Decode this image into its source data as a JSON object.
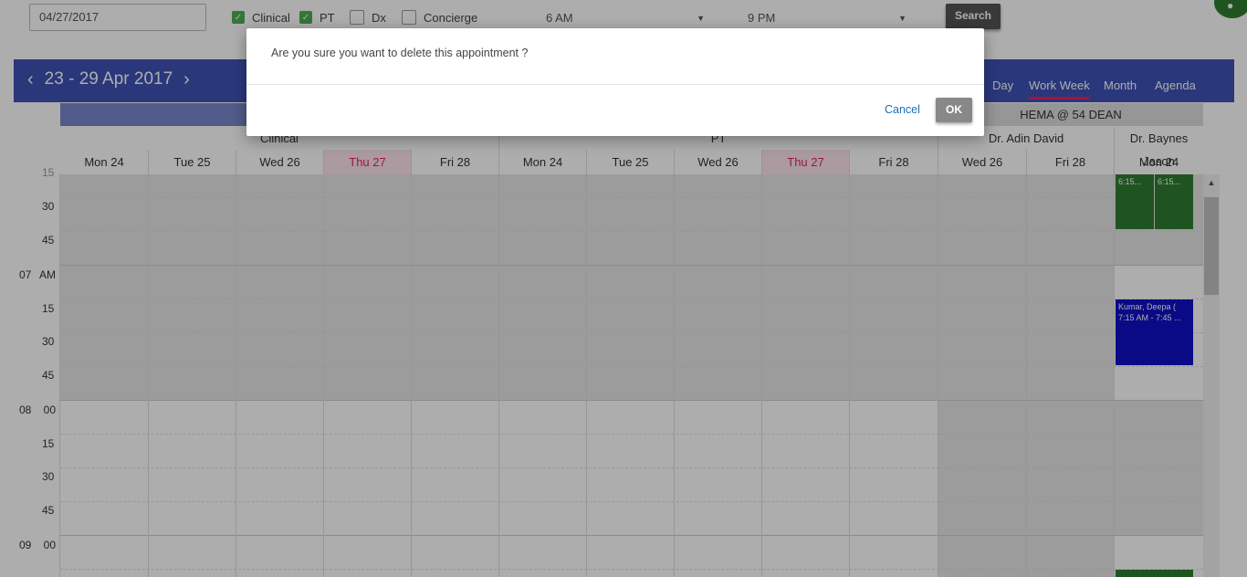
{
  "filters": {
    "date_value": "04/27/2017",
    "checkboxes": [
      {
        "label": "Clinical",
        "checked": true
      },
      {
        "label": "PT",
        "checked": true
      },
      {
        "label": "Dx",
        "checked": false
      },
      {
        "label": "Concierge",
        "checked": false
      }
    ],
    "start_time": "6 AM",
    "end_time": "9 PM",
    "search_label": "Search"
  },
  "header": {
    "date_range": "23 - 29 Apr 2017",
    "prev_icon": "chevron-left-icon",
    "next_icon": "chevron-right-icon",
    "views": [
      "Day",
      "Work Week",
      "Month",
      "Agenda"
    ],
    "active_view": "Work Week",
    "header_color": "#3f51b5"
  },
  "scheduler": {
    "group_label": "HEMA @ 54 DEAN",
    "resources": [
      "Clinical",
      "PT",
      "Dr. Adin David",
      "Dr. Baynes Jason"
    ],
    "days": [
      "Mon 24",
      "Tue 25",
      "Wed 26",
      "Thu 27",
      "Fri 28",
      "Mon 24",
      "Tue 25",
      "Wed 26",
      "Thu 27",
      "Fri 28",
      "Wed 26",
      "Fri 28",
      "Mon 24"
    ],
    "today_label": "Thu 27",
    "time_labels": [
      "15",
      "30",
      "45",
      "07 AM",
      "15",
      "30",
      "45",
      "08 00",
      "15",
      "30",
      "45",
      "09 00"
    ],
    "appointments": [
      {
        "title": "",
        "time": "6:15...",
        "color": "#2e7d32"
      },
      {
        "title": "",
        "time": "6:15...",
        "color": "#2e7d32"
      },
      {
        "title": "Kumar, Deepa (",
        "time": "7:15 AM - 7:45 ...",
        "color": "#1010c8"
      }
    ]
  },
  "dialog": {
    "message": "Are you sure you want to delete this appointment ?",
    "cancel_label": "Cancel",
    "ok_label": "OK"
  }
}
